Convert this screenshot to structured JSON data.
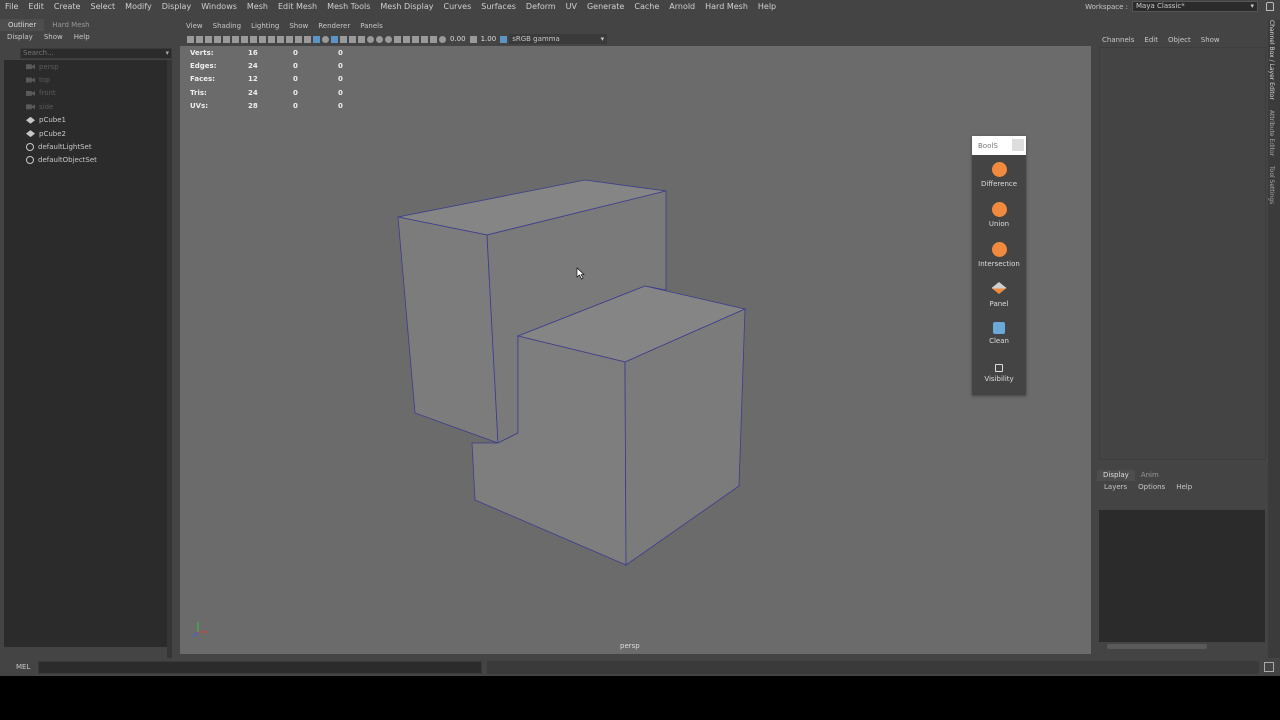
{
  "menubar": {
    "items": [
      "File",
      "Edit",
      "Create",
      "Select",
      "Modify",
      "Display",
      "Windows",
      "Mesh",
      "Edit Mesh",
      "Mesh Tools",
      "Mesh Display",
      "Curves",
      "Surfaces",
      "Deform",
      "UV",
      "Generate",
      "Cache",
      "Arnold",
      "Hard Mesh",
      "Help"
    ],
    "workspace_label": "Workspace :",
    "workspace_value": "Maya Classic*"
  },
  "outliner": {
    "tabs": [
      "Outliner",
      "Hard Mesh"
    ],
    "menu": [
      "Display",
      "Show",
      "Help"
    ],
    "search_placeholder": "Search...",
    "items": [
      {
        "label": "persp",
        "icon": "camera-icon",
        "dim": true
      },
      {
        "label": "top",
        "icon": "camera-icon",
        "dim": true
      },
      {
        "label": "front",
        "icon": "camera-icon",
        "dim": true
      },
      {
        "label": "side",
        "icon": "camera-icon",
        "dim": true
      },
      {
        "label": "pCube1",
        "icon": "mesh-icon",
        "dim": false
      },
      {
        "label": "pCube2",
        "icon": "mesh-icon",
        "dim": false
      },
      {
        "label": "defaultLightSet",
        "icon": "set-icon",
        "dim": false
      },
      {
        "label": "defaultObjectSet",
        "icon": "set-icon",
        "dim": false
      }
    ]
  },
  "viewport": {
    "menu": [
      "View",
      "Shading",
      "Lighting",
      "Show",
      "Renderer",
      "Panels"
    ],
    "exposure": "0.00",
    "gamma": "1.00",
    "color_space": "sRGB gamma",
    "camera_label": "persp",
    "hud": [
      {
        "label": "Verts:",
        "v1": "16",
        "v2": "0",
        "v3": "0"
      },
      {
        "label": "Edges:",
        "v1": "24",
        "v2": "0",
        "v3": "0"
      },
      {
        "label": "Faces:",
        "v1": "12",
        "v2": "0",
        "v3": "0"
      },
      {
        "label": "Tris:",
        "v1": "24",
        "v2": "0",
        "v3": "0"
      },
      {
        "label": "UVs:",
        "v1": "28",
        "v2": "0",
        "v3": "0"
      }
    ]
  },
  "boolpanel": {
    "title": "BoolS",
    "buttons": [
      {
        "label": "Difference",
        "icon": "difference-icon"
      },
      {
        "label": "Union",
        "icon": "union-icon"
      },
      {
        "label": "Intersection",
        "icon": "intersection-icon"
      },
      {
        "label": "Panel",
        "icon": "panel-icon"
      },
      {
        "label": "Clean",
        "icon": "clean-icon"
      },
      {
        "label": "Visibility",
        "icon": "visibility-icon"
      }
    ]
  },
  "channelbox": {
    "menu": [
      "Channels",
      "Edit",
      "Object",
      "Show"
    ],
    "layer_tabs": [
      "Display",
      "Anim"
    ],
    "layer_menu": [
      "Layers",
      "Options",
      "Help"
    ]
  },
  "side_tabs": [
    "Channel Box / Layer Editor",
    "Attribute Editor",
    "Tool Settings"
  ],
  "cmdline": {
    "label": "MEL"
  }
}
